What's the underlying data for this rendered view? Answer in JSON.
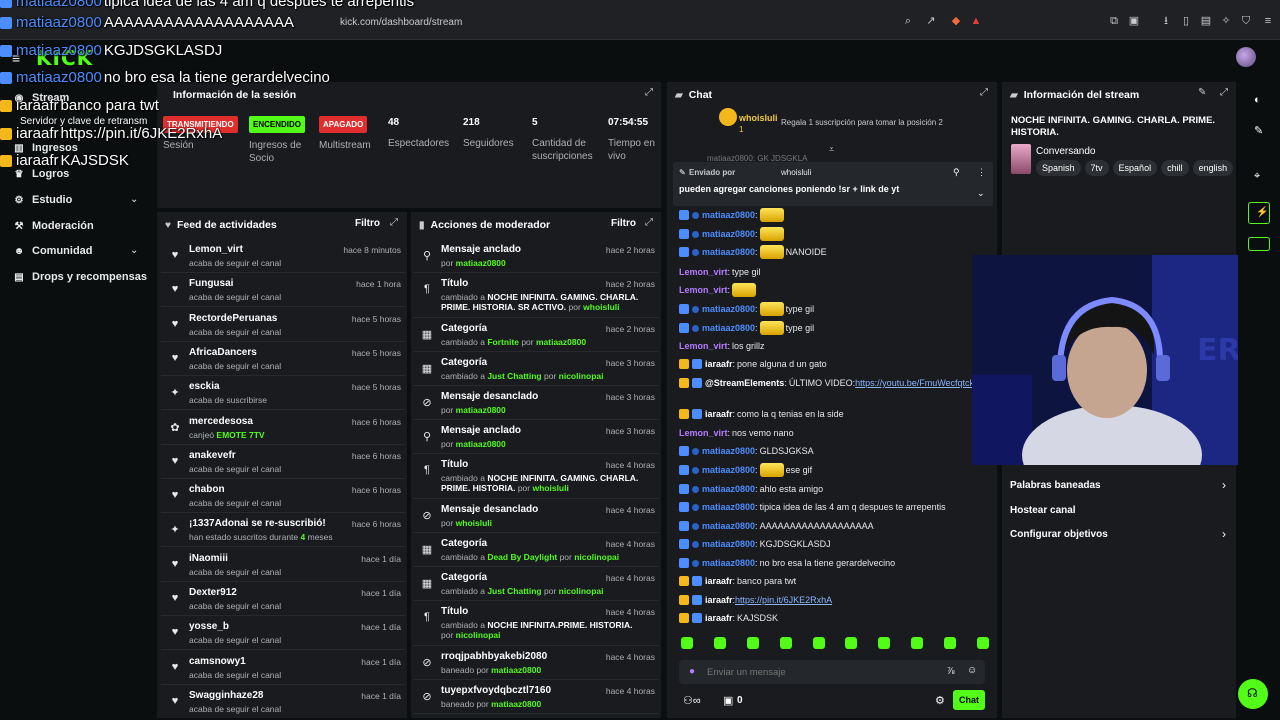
{
  "browser": {
    "url": "kick.com/dashboard/stream"
  },
  "header": {
    "logo": "KICK"
  },
  "sidebar": {
    "items": [
      {
        "label": "Stream",
        "icon": "broadcast-icon"
      },
      {
        "label": "Ingresos",
        "icon": "chart-icon"
      },
      {
        "label": "Logros",
        "icon": "trophy-icon"
      },
      {
        "label": "Estudio",
        "icon": "studio-icon"
      },
      {
        "label": "Moderación",
        "icon": "wrench-icon"
      },
      {
        "label": "Comunidad",
        "icon": "people-icon"
      },
      {
        "label": "Drops y recompensas",
        "icon": "gift-icon"
      }
    ]
  },
  "overlay_chat": [
    {
      "user": "matiaaz0800",
      "text": "tipica idea de las 4 am q despues te arrepentis"
    },
    {
      "user": "matiaaz0800",
      "text": "AAAAAAAAAAAAAAAAAAA"
    },
    {
      "user": "matiaaz0800",
      "text": "KGJDSGKLASDJ"
    },
    {
      "user": "matiaaz0800",
      "text": "no bro esa la tiene gerardelvecino"
    },
    {
      "user": "iaraafr",
      "text": "banco para twt"
    },
    {
      "user": "iaraafr",
      "text": "https://pin.it/6JKE2RxhA"
    },
    {
      "user": "iaraafr",
      "text": "KAJSDSK"
    },
    {
      "partial": "Servidor y clave de retransm"
    }
  ],
  "session": {
    "title": "Información de la sesión",
    "stats": [
      {
        "value": "TRANSMITIENDO",
        "label": "Sesión",
        "badge_color": "#e02d2d"
      },
      {
        "value": "ENCENDIDO",
        "label": "Ingresos de Socio",
        "badge_color": "#53fc18"
      },
      {
        "value": "APAGADO",
        "label": "Multistream",
        "badge_color": "#e02d2d"
      },
      {
        "value": "48",
        "label": "Espectadores"
      },
      {
        "value": "218",
        "label": "Seguidores"
      },
      {
        "value": "5",
        "label": "Cantidad de suscripciones"
      },
      {
        "value": "07:54:55",
        "label": "Tiempo en vivo"
      }
    ]
  },
  "feed": {
    "title": "Feed de actividades",
    "filter": "Filtro",
    "rows": [
      {
        "name": "Lemon_virt",
        "desc": "acaba de seguir el canal",
        "time": "hace 8 minutos",
        "icon": "heart-icon"
      },
      {
        "name": "Fungusai",
        "desc": "acaba de seguir el canal",
        "time": "hace 1 hora",
        "icon": "heart-icon"
      },
      {
        "name": "RectordePeruanas",
        "desc": "acaba de seguir el canal",
        "time": "hace 5 horas",
        "icon": "heart-icon"
      },
      {
        "name": "AfricaDancers",
        "desc": "acaba de seguir el canal",
        "time": "hace 5 horas",
        "icon": "heart-icon"
      },
      {
        "name": "esckia",
        "desc": "acaba de suscribirse",
        "time": "hace 5 horas",
        "icon": "star-icon"
      },
      {
        "name": "mercedesosa",
        "desc_pre": "canjeó ",
        "desc_hl": "EMOTE 7TV",
        "time": "hace 6 horas",
        "icon": "gift-icon"
      },
      {
        "name": "anakevefr",
        "desc": "acaba de seguir el canal",
        "time": "hace 6 horas",
        "icon": "heart-icon"
      },
      {
        "name": "chabon",
        "desc": "acaba de seguir el canal",
        "time": "hace 6 horas",
        "icon": "heart-icon"
      },
      {
        "name": "¡1337Adonai se re-suscribió!",
        "desc_pre": "han estado suscritos durante ",
        "desc_hl": "4",
        "desc_post": " meses",
        "time": "hace 6 horas",
        "icon": "star-icon"
      },
      {
        "name": "iNaomiii",
        "desc": "acaba de seguir el canal",
        "time": "hace 1 día",
        "icon": "heart-icon"
      },
      {
        "name": "Dexter912",
        "desc": "acaba de seguir el canal",
        "time": "hace 1 día",
        "icon": "heart-icon"
      },
      {
        "name": "yosse_b",
        "desc": "acaba de seguir el canal",
        "time": "hace 1 día",
        "icon": "heart-icon"
      },
      {
        "name": "camsnowy1",
        "desc": "acaba de seguir el canal",
        "time": "hace 1 día",
        "icon": "heart-icon"
      },
      {
        "name": "Swagginhaze28",
        "desc": "acaba de seguir el canal",
        "time": "hace 1 día",
        "icon": "heart-icon"
      }
    ]
  },
  "mod": {
    "title": "Acciones de moderador",
    "filter": "Filtro",
    "rows": [
      {
        "name": "Mensaje anclado",
        "pre": "por ",
        "g": "matiaaz0800",
        "time": "hace 2 horas",
        "icon": "pin-icon"
      },
      {
        "name": "Título",
        "pre": "cambiado a ",
        "w": "NOCHE INFINITA. GAMING. CHARLA. PRIME. HISTORIA. SR ACTIVO.",
        "mid": " por ",
        "g": "whoisluli",
        "time": "hace 2 horas",
        "icon": "title-icon"
      },
      {
        "name": "Categoría",
        "pre": "cambiado a ",
        "g": "Fortnite",
        "mid": " por ",
        "g2": "matiaaz0800",
        "time": "hace 2 horas",
        "icon": "category-icon"
      },
      {
        "name": "Categoría",
        "pre": "cambiado a ",
        "g": "Just Chatting",
        "mid": " por ",
        "g2": "nicolinopai",
        "time": "hace 3 horas",
        "icon": "category-icon"
      },
      {
        "name": "Mensaje desanclado",
        "pre": "por ",
        "g": "matiaaz0800",
        "time": "hace 3 horas",
        "icon": "unpin-icon"
      },
      {
        "name": "Mensaje anclado",
        "pre": "por ",
        "g": "matiaaz0800",
        "time": "hace 3 horas",
        "icon": "pin-icon"
      },
      {
        "name": "Título",
        "pre": "cambiado a ",
        "w": "NOCHE INFINITA. GAMING. CHARLA. PRIME. HISTORIA.",
        "mid": " por ",
        "g": "whoisluli",
        "time": "hace 4 horas",
        "icon": "title-icon"
      },
      {
        "name": "Mensaje desanclado",
        "pre": "por ",
        "g": "whoisluli",
        "time": "hace 4 horas",
        "icon": "unpin-icon"
      },
      {
        "name": "Categoría",
        "pre": "cambiado a ",
        "g": "Dead By Daylight",
        "mid": " por ",
        "g2": "nicolinopai",
        "time": "hace 4 horas",
        "icon": "category-icon"
      },
      {
        "name": "Categoría",
        "pre": "cambiado a ",
        "g": "Just Chatting",
        "mid": " por ",
        "g2": "nicolinopai",
        "time": "hace 4 horas",
        "icon": "category-icon"
      },
      {
        "name": "Título",
        "pre": "cambiado a ",
        "w": "NOCHE INFINITA.PRIME. HISTORIA.",
        "mid": " por ",
        "g": "nicolinopai",
        "time": "hace 4 horas",
        "icon": "title-icon"
      },
      {
        "name": "rroqjpabhbyakebi2080",
        "pre": "baneado por ",
        "g": "matiaaz0800",
        "time": "hace 4 horas",
        "icon": "ban-icon"
      },
      {
        "name": "tuyepxfvoydqbcztl7160",
        "pre": "baneado por ",
        "g": "matiaaz0800",
        "time": "hace 4 horas",
        "icon": "ban-icon"
      }
    ]
  },
  "chat": {
    "title": "Chat",
    "top_user": "whoisluli",
    "top_user_count": "1",
    "gift_prompt": "Regala 1 suscripción para tomar la posición 2",
    "hidden_line": "matiaaz0800: GK JDSGKLA",
    "pinned_by_label": "Enviado por",
    "pinned_user": "whoisluli",
    "pinned_text": "pueden agregar canciones poniendo !sr + link de yt",
    "messages": [
      {
        "user": "matiaaz0800",
        "color": "blue",
        "text": "",
        "emote": true
      },
      {
        "user": "matiaaz0800",
        "color": "blue",
        "text": "",
        "emote": true
      },
      {
        "user": "matiaaz0800",
        "color": "blue",
        "text": "NANOIDE",
        "emote": true
      },
      {
        "user": "Lemon_virt",
        "color": "purple",
        "text": "type gil"
      },
      {
        "user": "Lemon_virt",
        "color": "purple",
        "text": "",
        "emote": true
      },
      {
        "user": "matiaaz0800",
        "color": "blue",
        "text": "type gil",
        "emote": true
      },
      {
        "user": "matiaaz0800",
        "color": "blue",
        "text": "type gil",
        "emote": true
      },
      {
        "user": "Lemon_virt",
        "color": "purple",
        "text": "los grillz"
      },
      {
        "user": "iaraafr",
        "color": "white",
        "text": "pone alguna d un gato"
      },
      {
        "user": "@StreamElements",
        "color": "white",
        "text": "ÚLTIMO VIDEO: ",
        "link": "https://youtu.be/FmuWecfqtck"
      },
      {
        "user": "iaraafr",
        "color": "white",
        "text": "como la q tenias en la side"
      },
      {
        "user": "Lemon_virt",
        "color": "purple",
        "text": "nos vemo nano"
      },
      {
        "user": "matiaaz0800",
        "color": "blue",
        "text": "GLDSJGKSA"
      },
      {
        "user": "matiaaz0800",
        "color": "blue",
        "text": "ese gif",
        "emote": true
      },
      {
        "user": "matiaaz0800",
        "color": "blue",
        "text": "ahlo esta amigo"
      },
      {
        "user": "matiaaz0800",
        "color": "blue",
        "text": "tipica idea de las 4 am q despues te arrepentis"
      },
      {
        "user": "matiaaz0800",
        "color": "blue",
        "text": "AAAAAAAAAAAAAAAAAAA"
      },
      {
        "user": "matiaaz0800",
        "color": "blue",
        "text": "KGJDSGKLASDJ"
      },
      {
        "user": "matiaaz0800",
        "color": "blue",
        "text": "no bro esa la tiene gerardelvecino"
      },
      {
        "user": "iaraafr",
        "color": "white",
        "text": "banco para twt"
      },
      {
        "user": "iaraafr",
        "color": "white",
        "text": "",
        "link": "https://pin.it/6JKE2RxhA"
      },
      {
        "user": "iaraafr",
        "color": "white",
        "text": "KAJSDSK"
      }
    ],
    "input_placeholder": "Enviar un mensaje",
    "points": "0",
    "send_label": "Chat"
  },
  "info": {
    "title": "Información del stream",
    "stream_title": "NOCHE INFINITA. GAMING. CHARLA. PRIME. HISTORIA.",
    "category": "Conversando",
    "tags": [
      "Spanish",
      "7tv",
      "Español",
      "chill",
      "english"
    ],
    "links": [
      "Palabras baneadas",
      "Hostear canal",
      "Configurar objetivos"
    ]
  },
  "colors": {
    "accent": "#53fc18",
    "panel": "#191b1f",
    "background": "#0b0e0f"
  }
}
